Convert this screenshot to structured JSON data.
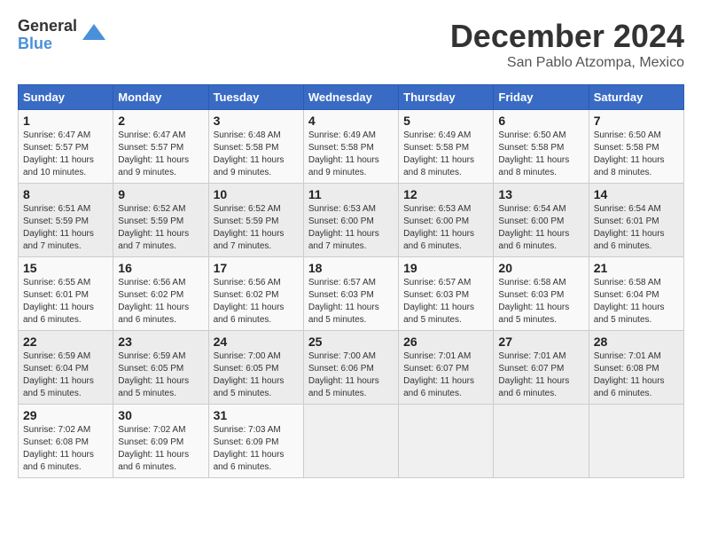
{
  "header": {
    "logo_general": "General",
    "logo_blue": "Blue",
    "month_title": "December 2024",
    "location": "San Pablo Atzompa, Mexico"
  },
  "weekdays": [
    "Sunday",
    "Monday",
    "Tuesday",
    "Wednesday",
    "Thursday",
    "Friday",
    "Saturday"
  ],
  "weeks": [
    [
      {
        "day": "1",
        "sunrise": "6:47 AM",
        "sunset": "5:57 PM",
        "daylight": "11 hours and 10 minutes."
      },
      {
        "day": "2",
        "sunrise": "6:47 AM",
        "sunset": "5:57 PM",
        "daylight": "11 hours and 9 minutes."
      },
      {
        "day": "3",
        "sunrise": "6:48 AM",
        "sunset": "5:58 PM",
        "daylight": "11 hours and 9 minutes."
      },
      {
        "day": "4",
        "sunrise": "6:49 AM",
        "sunset": "5:58 PM",
        "daylight": "11 hours and 9 minutes."
      },
      {
        "day": "5",
        "sunrise": "6:49 AM",
        "sunset": "5:58 PM",
        "daylight": "11 hours and 8 minutes."
      },
      {
        "day": "6",
        "sunrise": "6:50 AM",
        "sunset": "5:58 PM",
        "daylight": "11 hours and 8 minutes."
      },
      {
        "day": "7",
        "sunrise": "6:50 AM",
        "sunset": "5:58 PM",
        "daylight": "11 hours and 8 minutes."
      }
    ],
    [
      {
        "day": "8",
        "sunrise": "6:51 AM",
        "sunset": "5:59 PM",
        "daylight": "11 hours and 7 minutes."
      },
      {
        "day": "9",
        "sunrise": "6:52 AM",
        "sunset": "5:59 PM",
        "daylight": "11 hours and 7 minutes."
      },
      {
        "day": "10",
        "sunrise": "6:52 AM",
        "sunset": "5:59 PM",
        "daylight": "11 hours and 7 minutes."
      },
      {
        "day": "11",
        "sunrise": "6:53 AM",
        "sunset": "6:00 PM",
        "daylight": "11 hours and 7 minutes."
      },
      {
        "day": "12",
        "sunrise": "6:53 AM",
        "sunset": "6:00 PM",
        "daylight": "11 hours and 6 minutes."
      },
      {
        "day": "13",
        "sunrise": "6:54 AM",
        "sunset": "6:00 PM",
        "daylight": "11 hours and 6 minutes."
      },
      {
        "day": "14",
        "sunrise": "6:54 AM",
        "sunset": "6:01 PM",
        "daylight": "11 hours and 6 minutes."
      }
    ],
    [
      {
        "day": "15",
        "sunrise": "6:55 AM",
        "sunset": "6:01 PM",
        "daylight": "11 hours and 6 minutes."
      },
      {
        "day": "16",
        "sunrise": "6:56 AM",
        "sunset": "6:02 PM",
        "daylight": "11 hours and 6 minutes."
      },
      {
        "day": "17",
        "sunrise": "6:56 AM",
        "sunset": "6:02 PM",
        "daylight": "11 hours and 6 minutes."
      },
      {
        "day": "18",
        "sunrise": "6:57 AM",
        "sunset": "6:03 PM",
        "daylight": "11 hours and 5 minutes."
      },
      {
        "day": "19",
        "sunrise": "6:57 AM",
        "sunset": "6:03 PM",
        "daylight": "11 hours and 5 minutes."
      },
      {
        "day": "20",
        "sunrise": "6:58 AM",
        "sunset": "6:03 PM",
        "daylight": "11 hours and 5 minutes."
      },
      {
        "day": "21",
        "sunrise": "6:58 AM",
        "sunset": "6:04 PM",
        "daylight": "11 hours and 5 minutes."
      }
    ],
    [
      {
        "day": "22",
        "sunrise": "6:59 AM",
        "sunset": "6:04 PM",
        "daylight": "11 hours and 5 minutes."
      },
      {
        "day": "23",
        "sunrise": "6:59 AM",
        "sunset": "6:05 PM",
        "daylight": "11 hours and 5 minutes."
      },
      {
        "day": "24",
        "sunrise": "7:00 AM",
        "sunset": "6:05 PM",
        "daylight": "11 hours and 5 minutes."
      },
      {
        "day": "25",
        "sunrise": "7:00 AM",
        "sunset": "6:06 PM",
        "daylight": "11 hours and 5 minutes."
      },
      {
        "day": "26",
        "sunrise": "7:01 AM",
        "sunset": "6:07 PM",
        "daylight": "11 hours and 6 minutes."
      },
      {
        "day": "27",
        "sunrise": "7:01 AM",
        "sunset": "6:07 PM",
        "daylight": "11 hours and 6 minutes."
      },
      {
        "day": "28",
        "sunrise": "7:01 AM",
        "sunset": "6:08 PM",
        "daylight": "11 hours and 6 minutes."
      }
    ],
    [
      {
        "day": "29",
        "sunrise": "7:02 AM",
        "sunset": "6:08 PM",
        "daylight": "11 hours and 6 minutes."
      },
      {
        "day": "30",
        "sunrise": "7:02 AM",
        "sunset": "6:09 PM",
        "daylight": "11 hours and 6 minutes."
      },
      {
        "day": "31",
        "sunrise": "7:03 AM",
        "sunset": "6:09 PM",
        "daylight": "11 hours and 6 minutes."
      },
      null,
      null,
      null,
      null
    ]
  ]
}
